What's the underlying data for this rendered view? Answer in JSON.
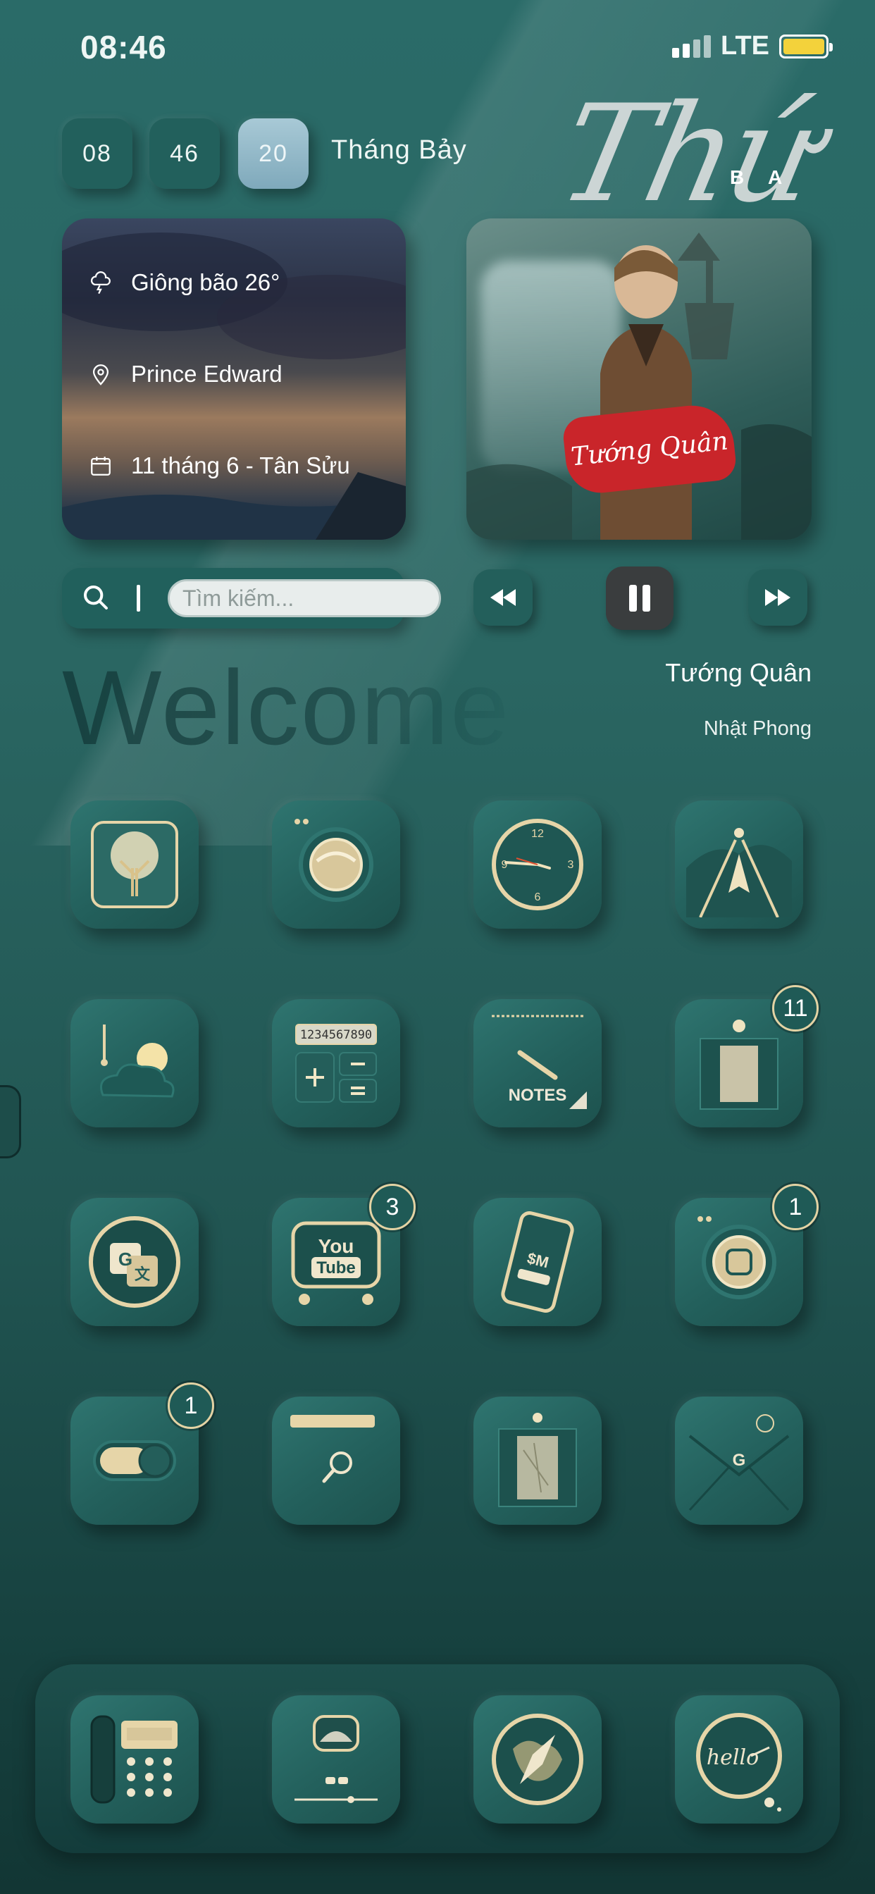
{
  "status_bar": {
    "time": "08:46",
    "network": "LTE",
    "battery_color": "#f3d23b"
  },
  "date_widget": {
    "hour": "08",
    "minute": "46",
    "day": "20",
    "month": "Tháng Bảy",
    "weekday": "Thứ",
    "weekday_suffix_1": "B",
    "weekday_suffix_2": "A"
  },
  "weather_widget": {
    "condition": "Giông bão 26°",
    "location": "Prince Edward",
    "lunar_date": "11 tháng 6 - Tân Sửu"
  },
  "music_widget": {
    "album_title": "Tướng Quân",
    "song_title": "Tướng Quân",
    "artist": "Nhật Phong"
  },
  "search": {
    "placeholder": "Tìm kiếm..."
  },
  "welcome_text": "Welcome",
  "apps": [
    {
      "name": "tree-icon",
      "badge": ""
    },
    {
      "name": "camera-lens-icon",
      "badge": ""
    },
    {
      "name": "clock-icon",
      "badge": ""
    },
    {
      "name": "maps-road-icon",
      "badge": ""
    },
    {
      "name": "weather-icon",
      "badge": ""
    },
    {
      "name": "calculator-icon",
      "badge": ""
    },
    {
      "name": "notes-icon",
      "badge": ""
    },
    {
      "name": "app-store-icon",
      "badge": "11"
    },
    {
      "name": "translate-icon",
      "badge": ""
    },
    {
      "name": "youtube-icon",
      "badge": "3"
    },
    {
      "name": "phone-manager-icon",
      "badge": ""
    },
    {
      "name": "instagram-icon",
      "badge": "1"
    },
    {
      "name": "settings-toggle-icon",
      "badge": "1"
    },
    {
      "name": "files-icon",
      "badge": ""
    },
    {
      "name": "photos-icon",
      "badge": ""
    },
    {
      "name": "gmail-icon",
      "badge": ""
    }
  ],
  "notes_label": "NOTES",
  "youtube_label_1": "You",
  "youtube_label_2": "Tube",
  "dock": [
    {
      "name": "phone-icon"
    },
    {
      "name": "music-player-icon"
    },
    {
      "name": "safari-compass-icon"
    },
    {
      "name": "messages-hello-icon"
    }
  ],
  "dock_hello": "hello",
  "calc_display": "1234567890"
}
